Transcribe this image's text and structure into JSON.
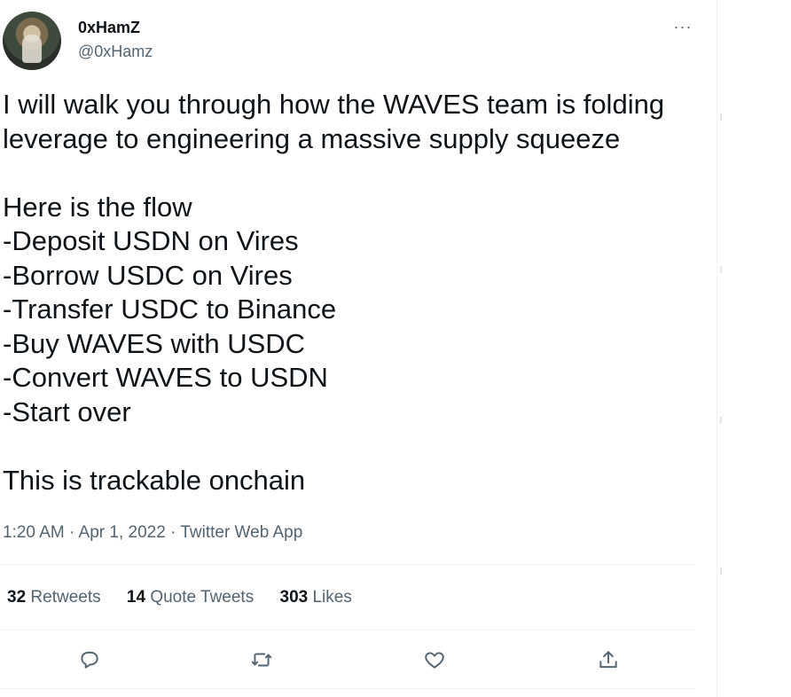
{
  "author": {
    "display_name": "0xHamZ",
    "handle": "@0xHamz"
  },
  "icons": {
    "more": "more-icon",
    "reply": "reply-icon",
    "retweet": "retweet-icon",
    "like": "like-icon",
    "share": "share-icon"
  },
  "more_label": "···",
  "tweet": {
    "text": "I will walk you through how the WAVES team is folding leverage to engineering a massive supply squeeze\n\nHere is the flow\n-Deposit USDN on Vires\n-Borrow USDC on Vires\n-Transfer USDC to Binance\n-Buy WAVES with USDC\n-Convert WAVES to USDN\n-Start over\n\nThis is trackable onchain",
    "meta": "1:20 AM · Apr 1, 2022 · Twitter Web App"
  },
  "stats": {
    "retweets_count": "32",
    "retweets_label": "Retweets",
    "quotes_count": "14",
    "quotes_label": "Quote Tweets",
    "likes_count": "303",
    "likes_label": "Likes"
  },
  "colors": {
    "text": "#0f1419",
    "secondary": "#536471",
    "divider": "#eff3f4"
  }
}
